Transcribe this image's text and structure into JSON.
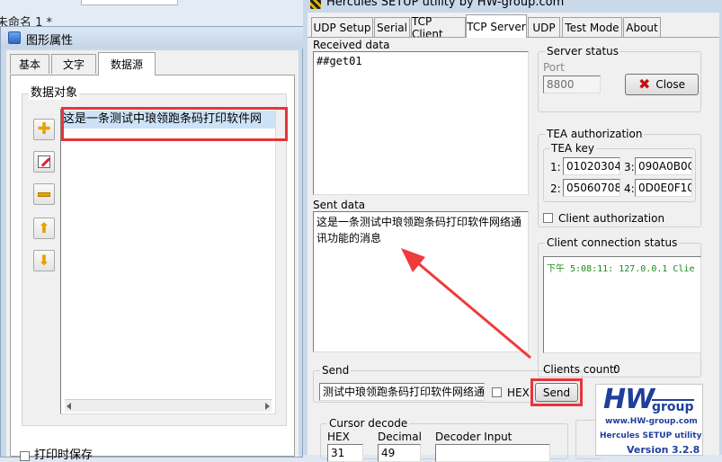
{
  "background_window": {
    "title": "未命名 1 *"
  },
  "props_window": {
    "title": "图形属性",
    "tabs": [
      "基本",
      "文字",
      "数据源"
    ],
    "active_tab": 2,
    "group_label": "数据对象",
    "list_item": "这是一条测试中琅领跑条码打印软件网",
    "bottom_checkbox": "打印时保存"
  },
  "hercules": {
    "title": "Hercules SETUP utility by HW-group.com",
    "tabs": [
      "UDP Setup",
      "Serial",
      "TCP Client",
      "TCP Server",
      "UDP",
      "Test Mode",
      "About"
    ],
    "active_tab": 3,
    "received_label": "Received data",
    "received_text": "##get01",
    "sent_label": "Sent data",
    "sent_text": "这是一条测试中琅领跑条码打印软件网络通讯功能的消息",
    "send_group_label": "Send",
    "send_input": "测试中琅领跑条码打印软件网络通",
    "hex_label": "HEX",
    "send_button": "Send",
    "cursor_decode": {
      "label": "Cursor decode",
      "hex_label": "HEX",
      "hex_value": "31",
      "decimal_label": "Decimal",
      "decimal_value": "49",
      "decoder_label": "Decoder Input",
      "decoder_value": ""
    },
    "server_status": {
      "label": "Server status",
      "port_label": "Port",
      "port_value": "8800",
      "close_button": "Close"
    },
    "tea": {
      "label": "TEA authorization",
      "key_label": "TEA key",
      "k1_label": "1:",
      "k1": "01020304",
      "k2_label": "2:",
      "k2": "05060708",
      "k3_label": "3:",
      "k3": "090A0B0C",
      "k4_label": "4:",
      "k4": "0D0E0F10",
      "client_auth": "Client authorization"
    },
    "client_status": {
      "label": "Client connection status",
      "entry": "下午 5:08:11:  127.0.0.1 Clie",
      "count_label": "Clients count:",
      "count": "0"
    },
    "logo": {
      "brand": "HW",
      "brand_suffix": "group",
      "url": "www.HW-group.com",
      "product": "Hercules SETUP utility",
      "version_label": "Version",
      "version": "3.2.8"
    }
  },
  "colors": {
    "highlight_red": "#e8343a",
    "arrow_red": "#ee3b3b",
    "logo_blue": "#1f3f9a",
    "client_text": "#1a8a1a"
  }
}
